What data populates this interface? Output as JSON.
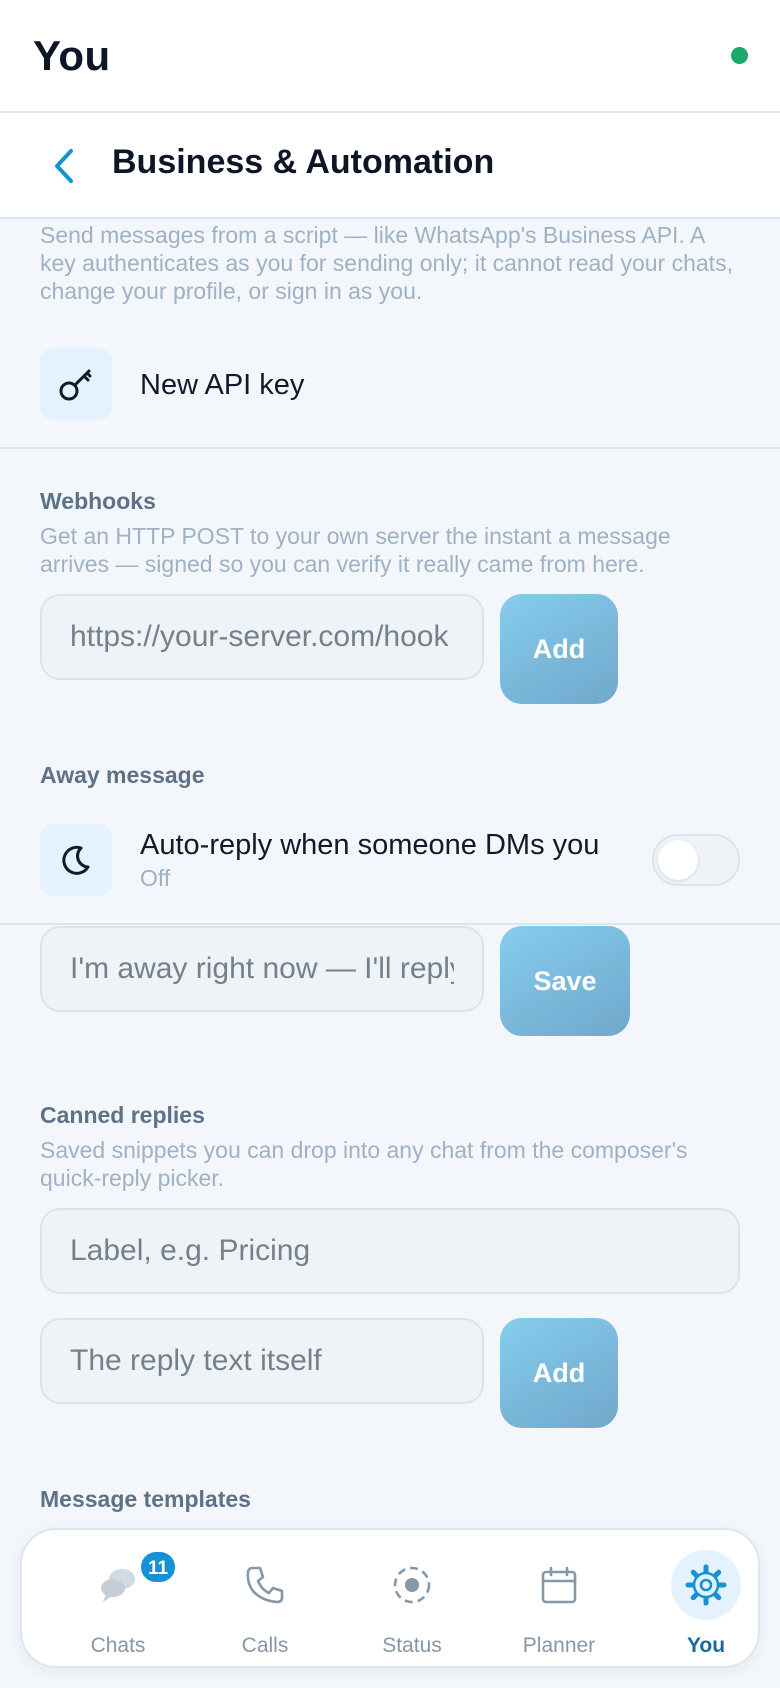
{
  "header": {
    "title": "You"
  },
  "subheader": {
    "title": "Business & Automation"
  },
  "api": {
    "description": "Send messages from a script — like WhatsApp's Business API. A key authenticates as you for sending only; it cannot read your chats, change your profile, or sign in as you.",
    "new_key_label": "New API key",
    "icon": "key-icon"
  },
  "webhooks": {
    "title": "Webhooks",
    "description": "Get an HTTP POST to your own server the instant a message arrives — signed so you can verify it really came from here.",
    "url_placeholder": "https://your-server.com/hook",
    "add_label": "Add"
  },
  "away": {
    "title": "Away message",
    "toggle_label": "Auto-reply when someone DMs you",
    "toggle_state": "Off",
    "toggle_on": false,
    "icon": "moon-icon",
    "message_placeholder": "I'm away right now — I'll reply soon",
    "save_label": "Save"
  },
  "canned": {
    "title": "Canned replies",
    "description": "Saved snippets you can drop into any chat from the composer's quick-reply picker.",
    "label_placeholder": "Label, e.g. Pricing",
    "text_placeholder": "The reply text itself",
    "add_label": "Add"
  },
  "templates": {
    "title": "Message templates"
  },
  "nav": {
    "items": [
      {
        "label": "Chats",
        "icon": "chat-bubbles-icon",
        "badge": "11"
      },
      {
        "label": "Calls",
        "icon": "phone-icon"
      },
      {
        "label": "Status",
        "icon": "status-ring-icon"
      },
      {
        "label": "Planner",
        "icon": "calendar-icon"
      },
      {
        "label": "You",
        "icon": "gear-icon",
        "active": true
      }
    ]
  },
  "colors": {
    "accent": "#1592d6",
    "online": "#1aa96b",
    "button": "#7ab8da",
    "active_nav": "#176b9c"
  }
}
